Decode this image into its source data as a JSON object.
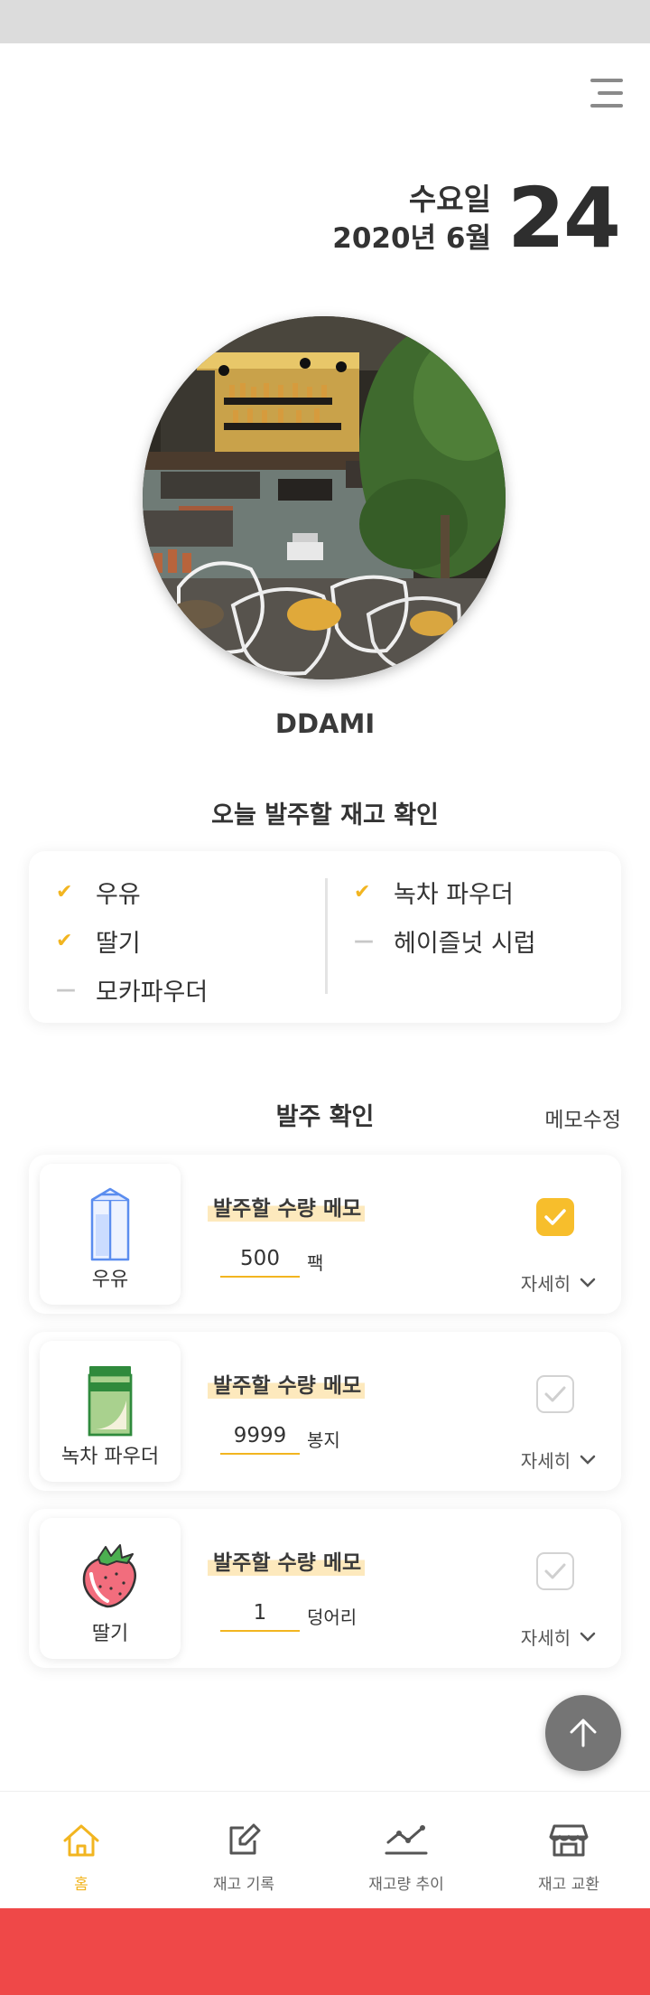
{
  "colors": {
    "accent": "#f7be2c",
    "active_nav": "#f2b520",
    "bottom_bar": "#ef4848",
    "fab": "#757575"
  },
  "header": {
    "menu_icon": "hamburger-icon"
  },
  "date": {
    "weekday": "수요일",
    "year_month": "2020년 6월",
    "day": "24"
  },
  "profile": {
    "photo_icon": "cafe-photo",
    "shop_name": "DDAMI"
  },
  "stock_check": {
    "title": "오늘 발주할 재고 확인",
    "left": [
      {
        "label": "우유",
        "status": "checked"
      },
      {
        "label": "딸기",
        "status": "checked"
      },
      {
        "label": "모카파우더",
        "status": "pending"
      }
    ],
    "right": [
      {
        "label": "녹차 파우더",
        "status": "checked"
      },
      {
        "label": "헤이즐넛 시럽",
        "status": "pending"
      }
    ]
  },
  "order_confirm": {
    "title": "발주 확인",
    "memo_edit": "메모수정",
    "items": [
      {
        "name": "우유",
        "icon": "milk-carton-icon",
        "memo_label": "발주할 수량 메모",
        "quantity": "500",
        "unit": "팩",
        "checked": true,
        "detail": "자세히"
      },
      {
        "name": "녹차 파우더",
        "icon": "green-tea-powder-icon",
        "memo_label": "발주할 수량 메모",
        "quantity": "9999",
        "unit": "봉지",
        "checked": false,
        "detail": "자세히"
      },
      {
        "name": "딸기",
        "icon": "strawberry-icon",
        "memo_label": "발주할 수량 메모",
        "quantity": "1",
        "unit": "덩어리",
        "checked": false,
        "detail": "자세히"
      }
    ]
  },
  "fab": {
    "icon": "arrow-up-icon"
  },
  "bottom_nav": [
    {
      "label": "홈",
      "icon": "home-icon",
      "active": true
    },
    {
      "label": "재고 기록",
      "icon": "edit-icon",
      "active": false
    },
    {
      "label": "재고량 추이",
      "icon": "trend-icon",
      "active": false
    },
    {
      "label": "재고 교환",
      "icon": "store-icon",
      "active": false
    }
  ]
}
